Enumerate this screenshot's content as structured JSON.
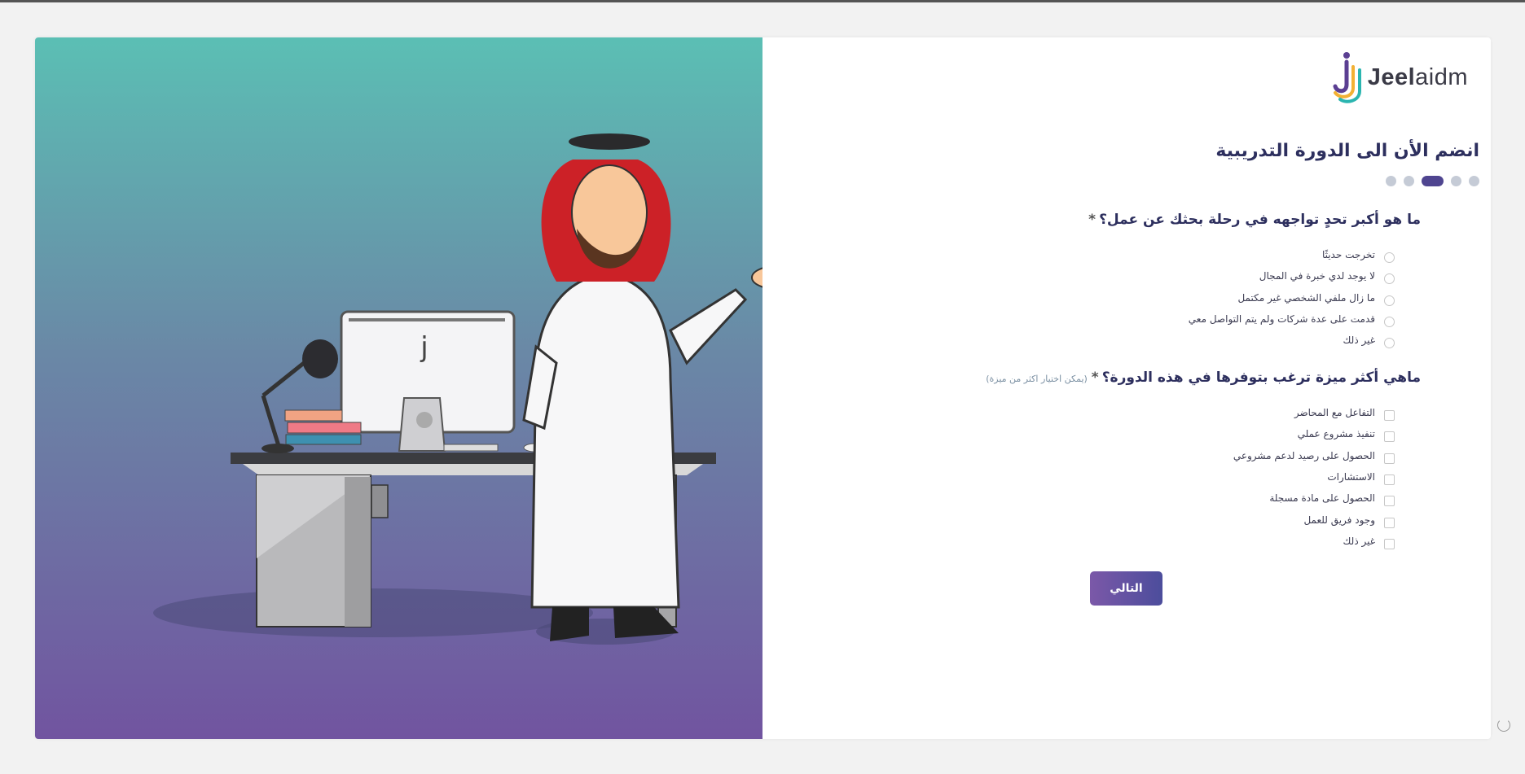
{
  "brand": {
    "name_bold": "Jeel",
    "name_light": "aidm",
    "colors": {
      "purple": "#5b3f92",
      "teal": "#2bb5b0",
      "yellow": "#f2b134"
    }
  },
  "form": {
    "title": "انضم الأن الى الدورة التدريبية",
    "steps": {
      "total": 5,
      "current": 3
    },
    "q1": {
      "label": "ما هو أكبر تحدٍ تواجهه في رحلة بحثك عن عمل؟",
      "required_mark": "*",
      "options": [
        "تخرجت حديثًا",
        "لا يوجد لدي خبرة في المجال",
        "ما زال ملفي الشخصي غير مكتمل",
        "قدمت على عدة شركات ولم يتم التواصل معي",
        "غير ذلك"
      ]
    },
    "q2": {
      "label": "ماهي أكثر ميزة ترغب بتوفرها في هذه الدورة؟",
      "required_mark": "*",
      "hint": "(يمكن اختيار اكثر من ميزة)",
      "options": [
        "التفاعل مع المحاضر",
        "تنفيذ مشروع عملي",
        "الحصول على رصيد لدعم مشروعي",
        "الاستشارات",
        "الحصول على مادة مسجلة",
        "وجود فريق للعمل",
        "غير ذلك"
      ]
    },
    "next_label": "التالي"
  },
  "colors": {
    "heading": "#2d2f5e",
    "button_from": "#7b58a8",
    "button_to": "#4c4d9c",
    "gradient_top": "#5bbfb4",
    "gradient_bottom": "#7154a0"
  }
}
